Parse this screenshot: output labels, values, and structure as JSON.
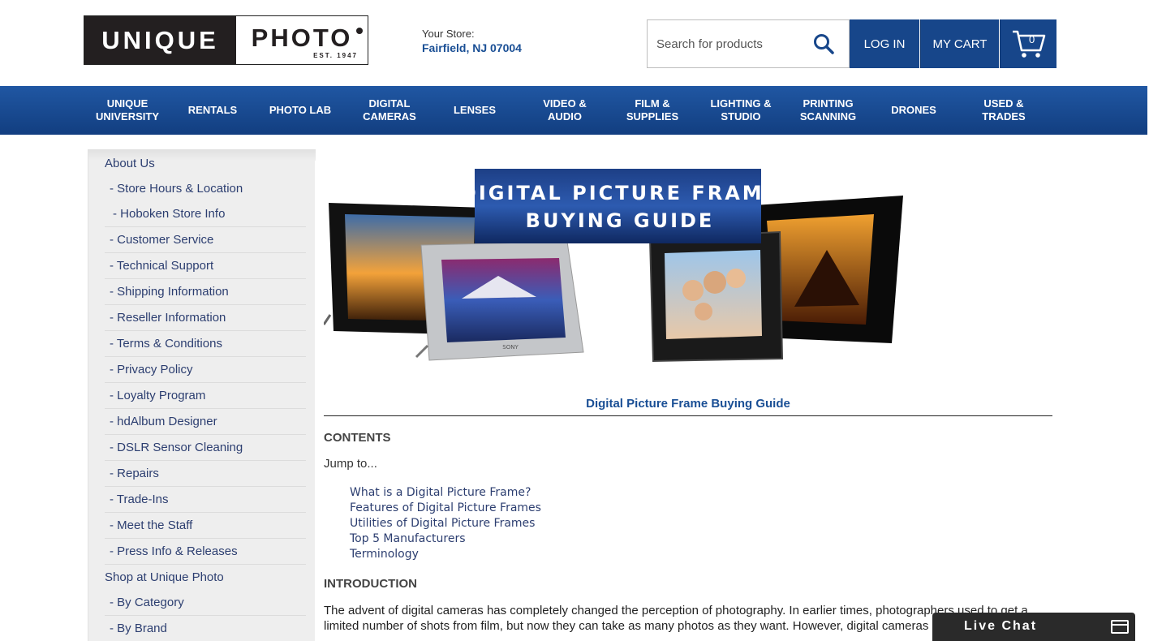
{
  "header": {
    "logo_left": "UNIQUE",
    "logo_right": "PHOTO",
    "logo_est": "EST. 1947",
    "store_label": "Your Store:",
    "store_location": "Fairfield, NJ 07004",
    "search_placeholder": "Search for products",
    "login_label": "LOG IN",
    "cart_label": "MY CART",
    "cart_count": "0"
  },
  "nav": {
    "items": [
      {
        "label": "UNIQUE\nUNIVERSITY"
      },
      {
        "label": "RENTALS"
      },
      {
        "label": "PHOTO LAB"
      },
      {
        "label": "DIGITAL\nCAMERAS"
      },
      {
        "label": "LENSES"
      },
      {
        "label": "VIDEO &\nAUDIO"
      },
      {
        "label": "FILM &\nSUPPLIES"
      },
      {
        "label": "LIGHTING &\nSTUDIO"
      },
      {
        "label": "PRINTING\nSCANNING"
      },
      {
        "label": "DRONES"
      },
      {
        "label": "USED &\nTRADES"
      }
    ]
  },
  "sidebar": {
    "about": "About Us",
    "about_links": [
      "- Store Hours & Location",
      " - Hoboken Store Info",
      "- Customer Service",
      "- Technical Support",
      "- Shipping Information",
      "- Reseller Information",
      "- Terms & Conditions",
      "- Privacy Policy",
      "- Loyalty Program",
      "- hdAlbum Designer",
      "- DSLR Sensor Cleaning",
      "- Repairs",
      "- Trade-Ins",
      "- Meet the Staff",
      "- Press Info & Releases"
    ],
    "shop": "Shop at Unique Photo",
    "shop_links": [
      "- By Category",
      "- By Brand"
    ]
  },
  "content": {
    "banner_line1": "DIGITAL PICTURE FRAME",
    "banner_line2": "BUYING GUIDE",
    "frame_brand": "SONY",
    "caption": "Digital Picture Frame Buying Guide",
    "contents_heading": "CONTENTS",
    "jump": "Jump to...",
    "toc": [
      "What is a Digital Picture Frame?",
      "Features of Digital Picture Frames",
      "Utilities of Digital Picture Frames",
      "Top 5 Manufacturers",
      "Terminology"
    ],
    "intro_heading": "INTRODUCTION",
    "intro_text": "The advent of digital cameras has completely changed the perception of photography. In earlier times, photographers used to get a limited number of shots from film, but now they can take as many photos as they want. However, digital cameras"
  },
  "chat": {
    "label": "Live Chat"
  },
  "colors": {
    "brand_blue": "#17468a",
    "nav_blue": "#1a4d94",
    "link": "#2c3e70"
  }
}
